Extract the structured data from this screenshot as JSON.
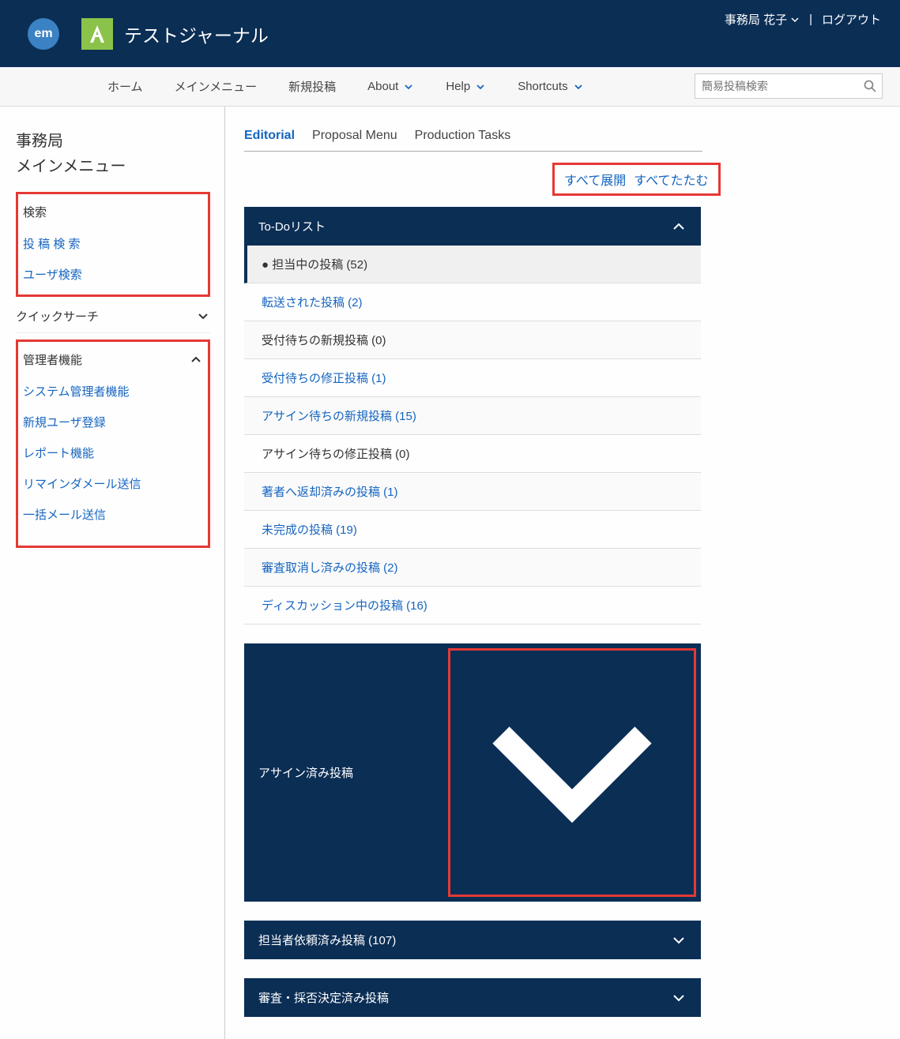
{
  "header": {
    "logo_em": "em",
    "journal_title": "テストジャーナル",
    "user_name": "事務局 花子",
    "logout": "ログアウト"
  },
  "navbar": {
    "items": [
      "ホーム",
      "メインメニュー",
      "新規投稿",
      "About",
      "Help",
      "Shortcuts"
    ],
    "search_placeholder": "簡易投稿検索"
  },
  "sidebar": {
    "title_line1": "事務局",
    "title_line2": "メインメニュー",
    "search_group": {
      "label": "検索",
      "items": [
        "投 稿 検 索",
        "ユーザ検索"
      ]
    },
    "quick_search": "クイックサーチ",
    "admin_group": {
      "label": "管理者機能",
      "items": [
        "システム管理者機能",
        "新規ユーザ登録",
        "レポート機能",
        "リマインダメール送信",
        "一括メール送信"
      ]
    }
  },
  "main": {
    "tabs": [
      "Editorial",
      "Proposal Menu",
      "Production Tasks"
    ],
    "expand_all": "すべて展開",
    "collapse_all": "すべてたたむ",
    "panels": {
      "todo": {
        "title": "To-Doリスト",
        "items": [
          {
            "label": "担当中の投稿 (52)",
            "active": true
          },
          {
            "label": "転送された投稿 (2)",
            "link": true
          },
          {
            "label": "受付待ちの新規投稿 (0)",
            "link": false,
            "alt": true
          },
          {
            "label": "受付待ちの修正投稿 (1)",
            "link": true
          },
          {
            "label": "アサイン待ちの新規投稿 (15)",
            "link": true,
            "alt": true
          },
          {
            "label": "アサイン待ちの修正投稿 (0)",
            "link": false
          },
          {
            "label": "著者へ返却済みの投稿 (1)",
            "link": true,
            "alt": true
          },
          {
            "label": "未完成の投稿 (19)",
            "link": true
          },
          {
            "label": "審査取消し済みの投稿 (2)",
            "link": true,
            "alt": true
          },
          {
            "label": "ディスカッション中の投稿 (16)",
            "link": true
          }
        ]
      },
      "assigned": "アサイン済み投稿",
      "requested": "担当者依頼済み投稿 (107)",
      "decided": "審査・採否決定済み投稿"
    }
  }
}
